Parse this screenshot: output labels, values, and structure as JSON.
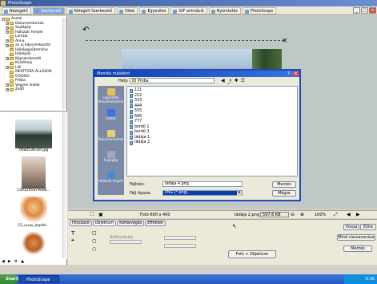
{
  "window": {
    "title": "PhotoScape"
  },
  "tabs": [
    {
      "label": "Nézegető"
    },
    {
      "label": "Szerkesztő",
      "active": true
    },
    {
      "label": "Kötegelt Szerkesztő"
    },
    {
      "label": "Oldal"
    },
    {
      "label": "Egyesítés"
    },
    {
      "label": "GIF animáció"
    },
    {
      "label": "Nyomtatás"
    },
    {
      "label": "PhotoScape"
    }
  ],
  "tree": [
    {
      "label": "Asztal",
      "depth": 0,
      "expand": "−"
    },
    {
      "label": "Dokumentumok",
      "depth": 1,
      "expand": "+"
    },
    {
      "label": "Sajátgép",
      "depth": 1,
      "expand": "+"
    },
    {
      "label": "Hálózati helyek",
      "depth": 1,
      "expand": "+"
    },
    {
      "label": "Lomtár",
      "depth": 1,
      "expand": ""
    },
    {
      "label": "Anna",
      "depth": 1,
      "expand": "+"
    },
    {
      "label": "az uj képszerkesztő",
      "depth": 1,
      "expand": "+"
    },
    {
      "label": "Hóképgyűjtemény",
      "depth": 1,
      "expand": ""
    },
    {
      "label": "Hóképek",
      "depth": 1,
      "expand": ""
    },
    {
      "label": "Képszerkesztő",
      "depth": 1,
      "expand": "+"
    },
    {
      "label": "Külsőhely",
      "depth": 1,
      "expand": ""
    },
    {
      "label": "Lilli",
      "depth": 1,
      "expand": "+"
    },
    {
      "label": "MERÍTÓRA ÁLLÁSOK",
      "depth": 1,
      "expand": ""
    },
    {
      "label": "OOOOO",
      "depth": 1,
      "expand": ""
    },
    {
      "label": "Próba",
      "depth": 1,
      "expand": ""
    },
    {
      "label": "Vegyes linkek",
      "depth": 1,
      "expand": "+"
    },
    {
      "label": "Zsófi",
      "depth": 1,
      "expand": "+"
    }
  ],
  "thumbnails": [
    {
      "label": "00b0538-Dd.jpg"
    },
    {
      "label": "1301291879ebb..."
    },
    {
      "label": "15_uuuu_kepfel..."
    }
  ],
  "status": {
    "size": "Fotó 600 x 400",
    "filename": "ládája 2.png",
    "filesize": "597.6 KB",
    "zoom": "100%"
  },
  "toolpanel": {
    "tabs": [
      "Főcsúszó",
      "Objektum",
      "Körbevágás",
      "Effektek"
    ],
    "active_tab": "Objektum",
    "object_button": "Fotó + Objektum",
    "back": "Vissza",
    "redo": "Előre",
    "restore_all": "Mind visszavonása",
    "save": "Mentés",
    "opacity_label": "Átlátszóság"
  },
  "dialog": {
    "title": "Mentés másként",
    "location_label": "Hely:",
    "location_value": "Próba",
    "places": [
      {
        "label": "Legutóbbi dokumentumok"
      },
      {
        "label": "Asztal"
      },
      {
        "label": "Dokumentumok"
      },
      {
        "label": "Sajátgép"
      },
      {
        "label": "Hálózati helyek"
      }
    ],
    "files": [
      "111",
      "222",
      "333",
      "444",
      "555",
      "666",
      "777",
      "bordó 1",
      "bordó 2",
      "ládája 1",
      "ládája 2"
    ],
    "filename_label": "Fájlnév:",
    "filename_value": "ládája 4.png",
    "filetype_label": "Fájl típusa:",
    "filetype_value": "PNG (*.png)",
    "save_button": "Mentés",
    "cancel_button": "Mégse"
  },
  "taskbar": {
    "start": "Start",
    "app": "PhotoScape",
    "clock": "6:36"
  }
}
